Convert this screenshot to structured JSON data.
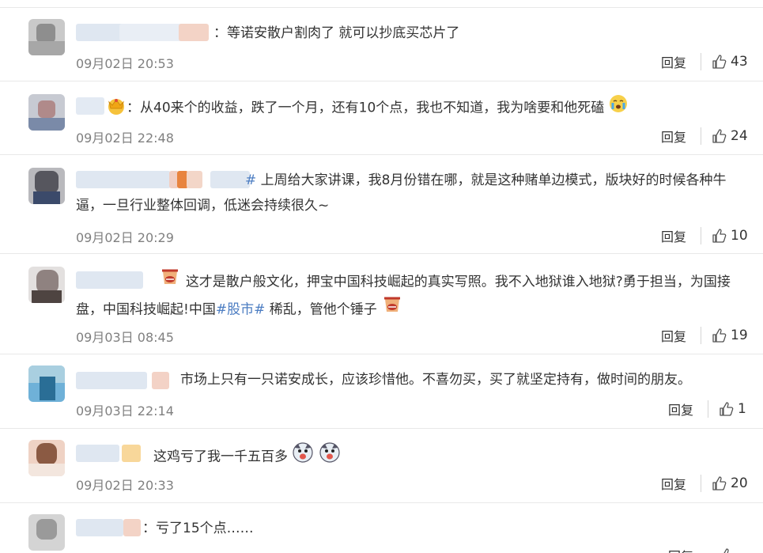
{
  "ui": {
    "reply_label": "回复",
    "hashtag_color": "#4c7dc2",
    "icons": {
      "like": "thumbs-up-icon",
      "crown": "crown-emoji",
      "cry": "crying-emoji",
      "shout": "shouting-emoji",
      "dog": "dog-emoji"
    }
  },
  "comments": [
    {
      "text": "：等诺安散户割肉了 就可以抄底买芯片了",
      "time": "09月02日 20:53",
      "likes": "43"
    },
    {
      "text": "：从40来个的收益，跌了一个月，还有10个点，我也不知道，我为啥要和他死磕",
      "time": "09月02日 22:48",
      "likes": "24"
    },
    {
      "tag": "#",
      "text": "上周给大家讲课，我8月份错在哪，就是这种赌单边模式，版块好的时候各种牛逼，一旦行业整体回调，低迷会持续很久~",
      "time": "09月02日 20:29",
      "likes": "10"
    },
    {
      "text_a": "这才是散户般文化，押宝中国科技崛起的真实写照。我不入地狱谁入地狱?勇于担当，为国接盘，中国科技崛起!中国",
      "tag": "#股市#",
      "text_b": "稀乱，管他个锤子",
      "time": "09月03日 08:45",
      "likes": "19"
    },
    {
      "text": "市场上只有一只诺安成长，应该珍惜他。不喜勿买，买了就坚定持有，做时间的朋友。",
      "time": "09月03日 22:14",
      "likes": "1"
    },
    {
      "text": "这鸡亏了我一千五百多",
      "time": "09月02日 20:33",
      "likes": "20"
    },
    {
      "text": "：亏了15个点……",
      "time": "",
      "likes": ""
    }
  ]
}
